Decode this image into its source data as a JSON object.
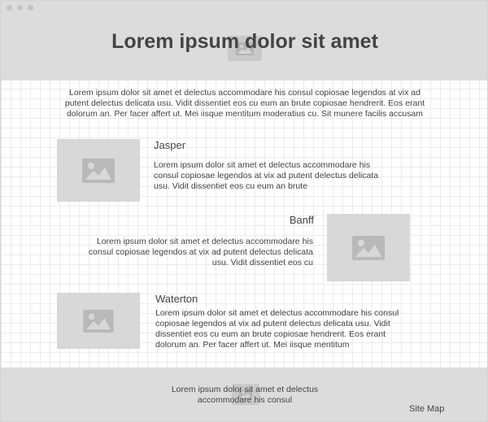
{
  "header": {
    "title": "Lorem ipsum dolor sit amet",
    "image_icon": "image-placeholder-icon"
  },
  "intro": {
    "text": "Lorem ipsum dolor sit amet et delectus accommodare his consul copiosae legendos at vix ad putent delectus delicata usu. Vidit dissentiet eos cu eum an brute copiosae hendrerit. Eos erant dolorum an. Per facer affert ut. Mei iisque mentitum moderatius cu. Sit munere facilis accusam"
  },
  "cards": [
    {
      "title": "Jasper",
      "text": "Lorem ipsum dolor sit amet et delectus accommodare his consul copiosae legendos at vix ad putent delectus delicata usu. Vidit dissentiet eos cu eum an brute",
      "image_icon": "image-placeholder-icon"
    },
    {
      "title": "Banff",
      "text": "Lorem ipsum dolor sit amet et delectus accommodare his consul copiosae legendos at vix ad putent delectus delicata usu. Vidit dissentiet eos cu",
      "image_icon": "image-placeholder-icon"
    },
    {
      "title": "Waterton",
      "text": "Lorem ipsum dolor sit amet et delectus accommodare his consul copiosae legendos at vix ad putent delectus delicata usu. Vidit dissentiet eos cu eum an brute copiosae hendrerit. Eos erant dolorum an. Per facer affert ut. Mei iisque mentitum",
      "image_icon": "image-placeholder-icon"
    }
  ],
  "footer": {
    "text": "Lorem ipsum dolor sit amet et delectus accommodare his consul",
    "sitemap_label": "Site Map",
    "image_icon": "image-placeholder-icon"
  },
  "colors": {
    "band_background": "#dcdcdc",
    "placeholder": "#d8d8d8",
    "placeholder_icon": "#b9b9b9",
    "text": "#444444"
  }
}
